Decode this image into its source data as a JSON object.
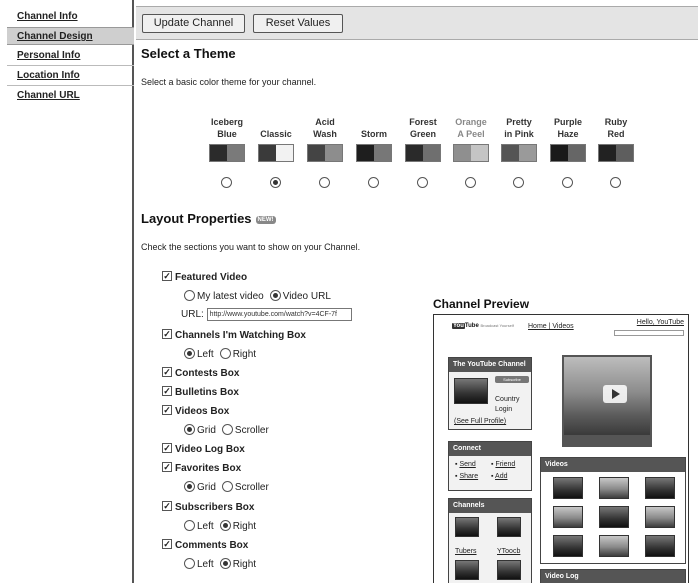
{
  "sidebar": {
    "items": [
      {
        "label": "Channel Info"
      },
      {
        "label": "Channel Design"
      },
      {
        "label": "Personal Info"
      },
      {
        "label": "Location Info"
      },
      {
        "label": "Channel URL"
      }
    ]
  },
  "toolbar": {
    "update_label": "Update Channel",
    "reset_label": "Reset Values"
  },
  "theme_section": {
    "title": "Select a Theme",
    "description": "Select a basic color theme for your channel.",
    "themes": [
      {
        "line1": "Iceberg",
        "line2": "Blue",
        "colors": [
          "#2b2b2b",
          "#7a7a7a"
        ],
        "selected": false
      },
      {
        "line1": "",
        "line2": "Classic",
        "colors": [
          "#3a3a3a",
          "#f2f2f2"
        ],
        "selected": true
      },
      {
        "line1": "Acid",
        "line2": "Wash",
        "colors": [
          "#444444",
          "#8d8d8d"
        ],
        "selected": false
      },
      {
        "line1": "",
        "line2": "Storm",
        "colors": [
          "#1e1e1e",
          "#777777"
        ],
        "selected": false
      },
      {
        "line1": "Forest",
        "line2": "Green",
        "colors": [
          "#2a2a2a",
          "#6f6f6f"
        ],
        "selected": false
      },
      {
        "line1": "Orange",
        "line2": "A Peel",
        "colors": [
          "#8f8f8f",
          "#c4c4c4"
        ],
        "selected": false,
        "muted": true
      },
      {
        "line1": "Pretty",
        "line2": "in Pink",
        "colors": [
          "#555555",
          "#9a9a9a"
        ],
        "selected": false
      },
      {
        "line1": "Purple",
        "line2": "Haze",
        "colors": [
          "#1a1a1a",
          "#666666"
        ],
        "selected": false
      },
      {
        "line1": "Ruby",
        "line2": "Red",
        "colors": [
          "#222222",
          "#5e5e5e"
        ],
        "selected": false
      }
    ]
  },
  "layout_section": {
    "title": "Layout Properties",
    "badge": "NEW!",
    "description": "Check the sections you want to show on your Channel.",
    "featured_video": {
      "label": "Featured Video",
      "checked": true,
      "options": [
        "My latest video",
        "Video URL"
      ],
      "selected": 1,
      "url_label": "URL:",
      "url_value": "http://www.youtube.com/watch?v=4CF-7f"
    },
    "boxes": [
      {
        "label": "Channels I'm Watching Box",
        "checked": true,
        "options": [
          "Left",
          "Right"
        ],
        "selected": 0
      },
      {
        "label": "Contests Box",
        "checked": true
      },
      {
        "label": "Bulletins Box",
        "checked": true
      },
      {
        "label": "Videos Box",
        "checked": true,
        "options": [
          "Grid",
          "Scroller"
        ],
        "selected": 0
      },
      {
        "label": "Video Log Box",
        "checked": true
      },
      {
        "label": "Favorites Box",
        "checked": true,
        "options": [
          "Grid",
          "Scroller"
        ],
        "selected": 0
      },
      {
        "label": "Subscribers Box",
        "checked": true,
        "options": [
          "Left",
          "Right"
        ],
        "selected": 1
      },
      {
        "label": "Comments Box",
        "checked": true,
        "options": [
          "Left",
          "Right"
        ],
        "selected": 1
      }
    ]
  },
  "preview": {
    "title": "Channel Preview",
    "logo": "You",
    "logo_tube": "Tube",
    "logo_sub": "Broadcast Yourself",
    "nav": "Home | Videos",
    "hello": "Hello, YouTube",
    "channel_box_title": "The YouTube Channel",
    "subscribe_label": "Subscribe",
    "country": "Country",
    "login": "Login",
    "see_profile": "(See Full Profile)",
    "connect_title": "Connect",
    "connect_links": [
      "Send",
      "Friend",
      "Share",
      "Add"
    ],
    "channels_title": "Channels",
    "channel_names": [
      "Tubers",
      "YToocb"
    ],
    "videos_title": "Videos",
    "video_log_title": "Video Log"
  }
}
